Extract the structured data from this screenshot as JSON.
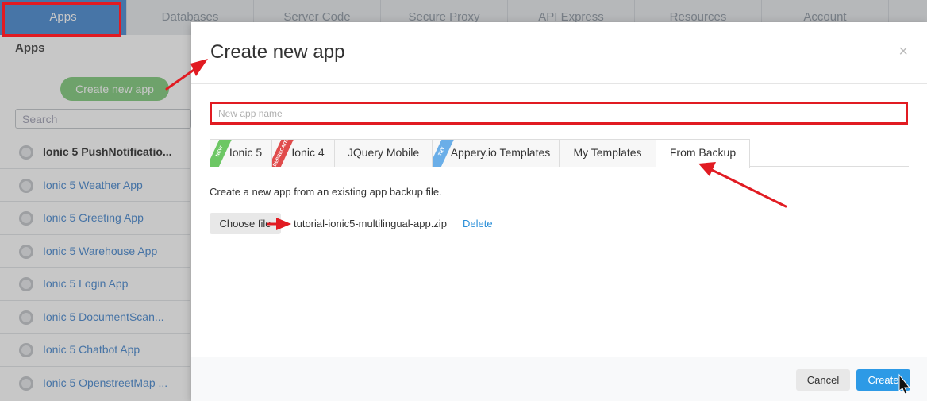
{
  "topnav": {
    "tabs": [
      "Apps",
      "Databases",
      "Server Code",
      "Secure Proxy",
      "API Express",
      "Resources",
      "Account"
    ]
  },
  "sidebar": {
    "title": "Apps",
    "create_button": "Create new app",
    "search_placeholder": "Search",
    "apps": [
      "Ionic 5 PushNotificatio...",
      "Ionic 5 Weather App",
      "Ionic 5 Greeting App",
      "Ionic 5 Warehouse App",
      "Ionic 5 Login App",
      "Ionic 5 DocumentScan...",
      "Ionic 5 Chatbot App",
      "Ionic 5 OpenstreetMap ..."
    ]
  },
  "modal": {
    "title": "Create new app",
    "close": "×",
    "name_placeholder": "New app name",
    "tabs": [
      {
        "label": "Ionic 5",
        "ribbon": "NEW"
      },
      {
        "label": "Ionic 4",
        "ribbon": "DEPRECATED"
      },
      {
        "label": "JQuery Mobile",
        "ribbon": ""
      },
      {
        "label": "Appery.io Templates",
        "ribbon": "TRY"
      },
      {
        "label": "My Templates",
        "ribbon": ""
      },
      {
        "label": "From Backup",
        "ribbon": ""
      }
    ],
    "active_tab": "From Backup",
    "description": "Create a new app from an existing app backup file.",
    "choose_file": "Choose file",
    "file_name": "tutorial-ionic5-multilingual-app.zip",
    "delete": "Delete",
    "cancel": "Cancel",
    "create": "Create"
  },
  "colors": {
    "annotation_red": "#e11b22",
    "primary_blue": "#2d9ae6",
    "active_nav": "#5b96d6",
    "create_green": "#8ed08a"
  }
}
